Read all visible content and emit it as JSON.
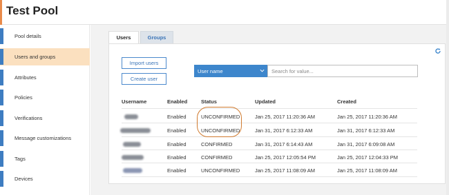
{
  "header": {
    "title": "Test Pool"
  },
  "sidebar": {
    "items": [
      {
        "label": "Pool details",
        "active": false
      },
      {
        "label": "Users and groups",
        "active": true
      },
      {
        "label": "Attributes",
        "active": false
      },
      {
        "label": "Policies",
        "active": false
      },
      {
        "label": "Verifications",
        "active": false
      },
      {
        "label": "Message customizations",
        "active": false
      },
      {
        "label": "Tags",
        "active": false
      },
      {
        "label": "Devices",
        "active": false
      }
    ]
  },
  "tabs": [
    {
      "label": "Users",
      "active": true
    },
    {
      "label": "Groups",
      "active": false
    }
  ],
  "actions": {
    "import_label": "Import users",
    "create_label": "Create user"
  },
  "search": {
    "attribute": "User name",
    "placeholder": "Search for value..."
  },
  "table": {
    "headers": [
      "Username",
      "Enabled",
      "Status",
      "Updated",
      "Created"
    ],
    "rows": [
      {
        "username": "",
        "enabled": "Enabled",
        "status": "UNCONFIRMED",
        "updated": "Jan 25, 2017 11:20:36 AM",
        "created": "Jan 25, 2017 11:20:36 AM"
      },
      {
        "username": "",
        "enabled": "Enabled",
        "status": "UNCONFIRMED",
        "updated": "Jan 31, 2017 6:12:33 AM",
        "created": "Jan 31, 2017 6:12:33 AM"
      },
      {
        "username": "",
        "enabled": "Enabled",
        "status": "CONFIRMED",
        "updated": "Jan 31, 2017 6:14:43 AM",
        "created": "Jan 31, 2017 6:09:08 AM"
      },
      {
        "username": "",
        "enabled": "Enabled",
        "status": "CONFIRMED",
        "updated": "Jan 25, 2017 12:05:54 PM",
        "created": "Jan 25, 2017 12:04:33 PM"
      },
      {
        "username": "",
        "enabled": "Enabled",
        "status": "UNCONFIRMED",
        "updated": "Jan 25, 2017 11:08:09 AM",
        "created": "Jan 25, 2017 11:08:09 AM"
      }
    ]
  },
  "colors": {
    "accent": "#3d86cc",
    "active_item": "#fbe0bf",
    "highlight": "#d07a2e"
  }
}
